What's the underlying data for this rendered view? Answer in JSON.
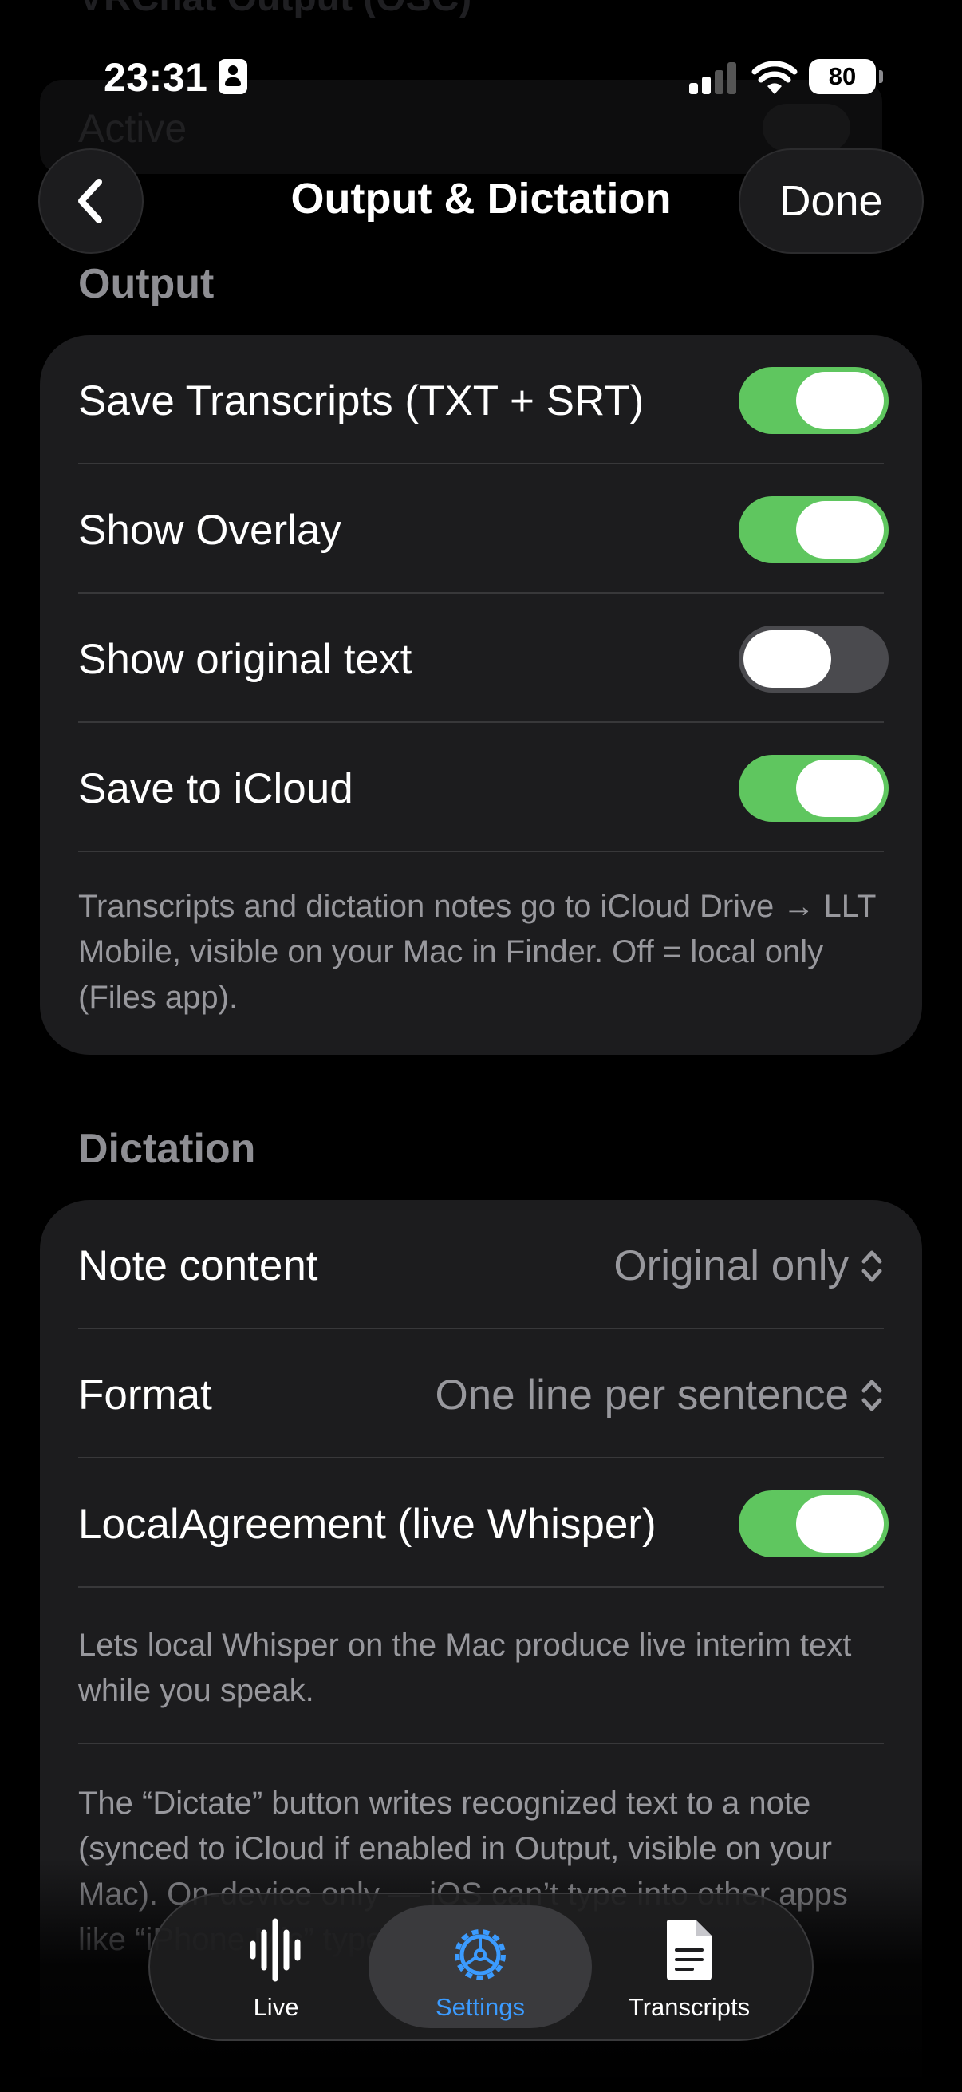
{
  "status_bar": {
    "time": "23:31",
    "battery": "80"
  },
  "nav": {
    "title": "Output & Dictation",
    "done_label": "Done"
  },
  "ghost": {
    "title": "VRChat Output (OSC)",
    "row_label": "Active"
  },
  "output": {
    "header": "Output",
    "rows": [
      {
        "label": "Save Transcripts (TXT + SRT)",
        "on": true
      },
      {
        "label": "Show Overlay",
        "on": true
      },
      {
        "label": "Show original text",
        "on": false
      },
      {
        "label": "Save to iCloud",
        "on": true
      }
    ],
    "footnote": "Transcripts and dictation notes go to iCloud Drive → LLT Mobile, visible on your Mac in Finder. Off = local only (Files app)."
  },
  "dictation": {
    "header": "Dictation",
    "note_content": {
      "label": "Note content",
      "value": "Original only"
    },
    "format": {
      "label": "Format",
      "value": "One line per sentence"
    },
    "local_agreement": {
      "label": "LocalAgreement (live Whisper)",
      "on": true
    },
    "footnote1": "Lets local Whisper on the Mac produce live interim text while you speak.",
    "footnote2": "The “Dictate” button writes recognized text to a note (synced to iCloud if enabled in Output, visible on your Mac). On-device only — iOS can’t type into other apps like “iPhone Mic” type in the Mac."
  },
  "tabs": [
    {
      "label": "Live",
      "icon": "waveform-icon"
    },
    {
      "label": "Settings",
      "icon": "gear-icon"
    },
    {
      "label": "Transcripts",
      "icon": "document-icon"
    }
  ],
  "colors": {
    "toggle_on": "#5fc65f",
    "accent": "#3b9bff",
    "card": "#1c1c1e"
  }
}
